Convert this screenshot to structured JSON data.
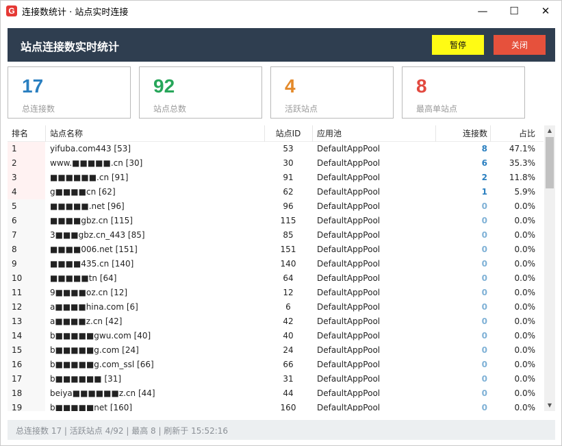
{
  "window": {
    "icon": "G",
    "title": "连接数统计 · 站点实时连接",
    "minimize": "—",
    "maximize": "☐",
    "close": "✕"
  },
  "header": {
    "title": "站点连接数实时统计",
    "pause_label": "暂停",
    "close_label": "关闭"
  },
  "stats": [
    {
      "value": "17",
      "label": "总连接数",
      "color": "#2a7fc0"
    },
    {
      "value": "92",
      "label": "站点总数",
      "color": "#27a65a"
    },
    {
      "value": "4",
      "label": "活跃站点",
      "color": "#e48a2b"
    },
    {
      "value": "8",
      "label": "最高单站点",
      "color": "#e2493f"
    }
  ],
  "table": {
    "columns": [
      "排名",
      "站点名称",
      "站点ID",
      "应用池",
      "连接数",
      "占比"
    ],
    "rows": [
      {
        "rank": "1",
        "name": "yifuba.com443 [53]",
        "id": "53",
        "pool": "DefaultAppPool",
        "conn": "8",
        "pct": "47.1%"
      },
      {
        "rank": "2",
        "name": "www.■■■■■.cn [30]",
        "id": "30",
        "pool": "DefaultAppPool",
        "conn": "6",
        "pct": "35.3%"
      },
      {
        "rank": "3",
        "name": "■■■■■■.cn [91]",
        "id": "91",
        "pool": "DefaultAppPool",
        "conn": "2",
        "pct": "11.8%"
      },
      {
        "rank": "4",
        "name": "g■■■■cn [62]",
        "id": "62",
        "pool": "DefaultAppPool",
        "conn": "1",
        "pct": "5.9%"
      },
      {
        "rank": "5",
        "name": "■■■■■.net [96]",
        "id": "96",
        "pool": "DefaultAppPool",
        "conn": "0",
        "pct": "0.0%"
      },
      {
        "rank": "6",
        "name": "■■■■gbz.cn [115]",
        "id": "115",
        "pool": "DefaultAppPool",
        "conn": "0",
        "pct": "0.0%"
      },
      {
        "rank": "7",
        "name": "3■■■gbz.cn_443 [85]",
        "id": "85",
        "pool": "DefaultAppPool",
        "conn": "0",
        "pct": "0.0%"
      },
      {
        "rank": "8",
        "name": "■■■■006.net [151]",
        "id": "151",
        "pool": "DefaultAppPool",
        "conn": "0",
        "pct": "0.0%"
      },
      {
        "rank": "9",
        "name": "■■■■435.cn [140]",
        "id": "140",
        "pool": "DefaultAppPool",
        "conn": "0",
        "pct": "0.0%"
      },
      {
        "rank": "10",
        "name": "■■■■■tn [64]",
        "id": "64",
        "pool": "DefaultAppPool",
        "conn": "0",
        "pct": "0.0%"
      },
      {
        "rank": "11",
        "name": "9■■■■oz.cn [12]",
        "id": "12",
        "pool": "DefaultAppPool",
        "conn": "0",
        "pct": "0.0%"
      },
      {
        "rank": "12",
        "name": "a■■■■hina.com [6]",
        "id": "6",
        "pool": "DefaultAppPool",
        "conn": "0",
        "pct": "0.0%"
      },
      {
        "rank": "13",
        "name": "a■■■■z.cn [42]",
        "id": "42",
        "pool": "DefaultAppPool",
        "conn": "0",
        "pct": "0.0%"
      },
      {
        "rank": "14",
        "name": "b■■■■■gwu.com [40]",
        "id": "40",
        "pool": "DefaultAppPool",
        "conn": "0",
        "pct": "0.0%"
      },
      {
        "rank": "15",
        "name": "b■■■■■g.com [24]",
        "id": "24",
        "pool": "DefaultAppPool",
        "conn": "0",
        "pct": "0.0%"
      },
      {
        "rank": "16",
        "name": "b■■■■■g.com_ssl [66]",
        "id": "66",
        "pool": "DefaultAppPool",
        "conn": "0",
        "pct": "0.0%"
      },
      {
        "rank": "17",
        "name": "b■■■■■■ [31]",
        "id": "31",
        "pool": "DefaultAppPool",
        "conn": "0",
        "pct": "0.0%"
      },
      {
        "rank": "18",
        "name": "beiya■■■■■■z.cn [44]",
        "id": "44",
        "pool": "DefaultAppPool",
        "conn": "0",
        "pct": "0.0%"
      },
      {
        "rank": "19",
        "name": "b■■■■■net [160]",
        "id": "160",
        "pool": "DefaultAppPool",
        "conn": "0",
        "pct": "0.0%"
      }
    ]
  },
  "colors": {
    "conn_active": "#2a7fc0",
    "conn_zero": "#7fb1d6"
  },
  "status": {
    "text": "总连接数 17 | 活跃站点 4/92 | 最高 8 | 刷新于 15:52:16"
  }
}
